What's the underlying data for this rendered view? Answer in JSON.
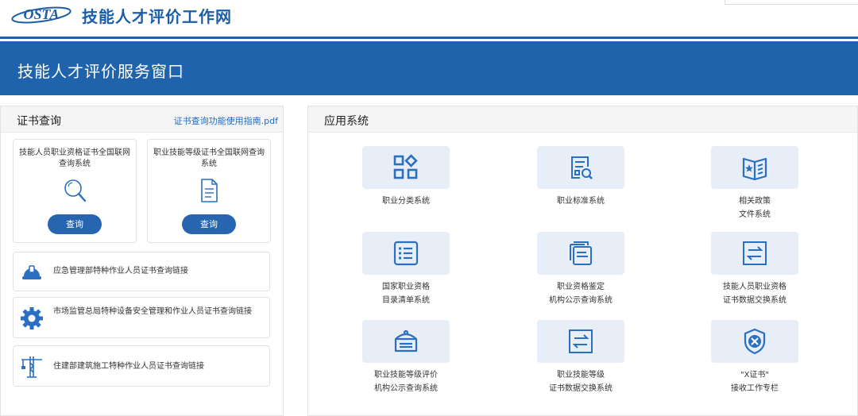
{
  "header": {
    "logo_text": "OSTA",
    "site_title": "技能人才评价工作网"
  },
  "banner": {
    "title": "技能人才评价服务窗口"
  },
  "cert_query": {
    "title": "证书查询",
    "guide_link": "证书查询功能使用指南.pdf",
    "cards": [
      {
        "name": "技能人员职业资格证书全国联网查询系统",
        "button": "查询",
        "icon": "magnifier-icon"
      },
      {
        "name": "职业技能等级证书全国联网查询系统",
        "button": "查询",
        "icon": "document-icon"
      }
    ],
    "links": [
      {
        "text": "应急管理部特种作业人员证书查询链接",
        "icon": "hardhat-icon"
      },
      {
        "text": "市场监管总局特种设备安全管理和作业人员证书查询链接",
        "icon": "gear-icon"
      },
      {
        "text": "住建部建筑施工特种作业人员证书查询链接",
        "icon": "tower-crane-icon"
      }
    ]
  },
  "apps": {
    "title": "应用系统",
    "items": [
      {
        "line1": "职业分类系统",
        "line2": "",
        "icon": "category-grid-icon"
      },
      {
        "line1": "职业标准系统",
        "line2": "",
        "icon": "standard-search-icon"
      },
      {
        "line1": "相关政策",
        "line2": "文件系统",
        "icon": "policy-book-icon"
      },
      {
        "line1": "国家职业资格",
        "line2": "目录清单系统",
        "icon": "list-icon"
      },
      {
        "line1": "职业资格鉴定",
        "line2": "机构公示查询系统",
        "icon": "documents-icon"
      },
      {
        "line1": "技能人员职业资格",
        "line2": "证书数据交换系统",
        "icon": "exchange-icon"
      },
      {
        "line1": "职业技能等级评价",
        "line2": "机构公示查询系统",
        "icon": "institution-icon"
      },
      {
        "line1": "职业技能等级",
        "line2": "证书数据交换系统",
        "icon": "exchange-icon"
      },
      {
        "line1": "\"X证书\"",
        "line2": "接收工作专栏",
        "icon": "x-badge-icon"
      }
    ]
  },
  "colors": {
    "brand_blue": "#1f63ac",
    "tile_bg": "#e8eef7",
    "button_blue": "#2865b0"
  }
}
